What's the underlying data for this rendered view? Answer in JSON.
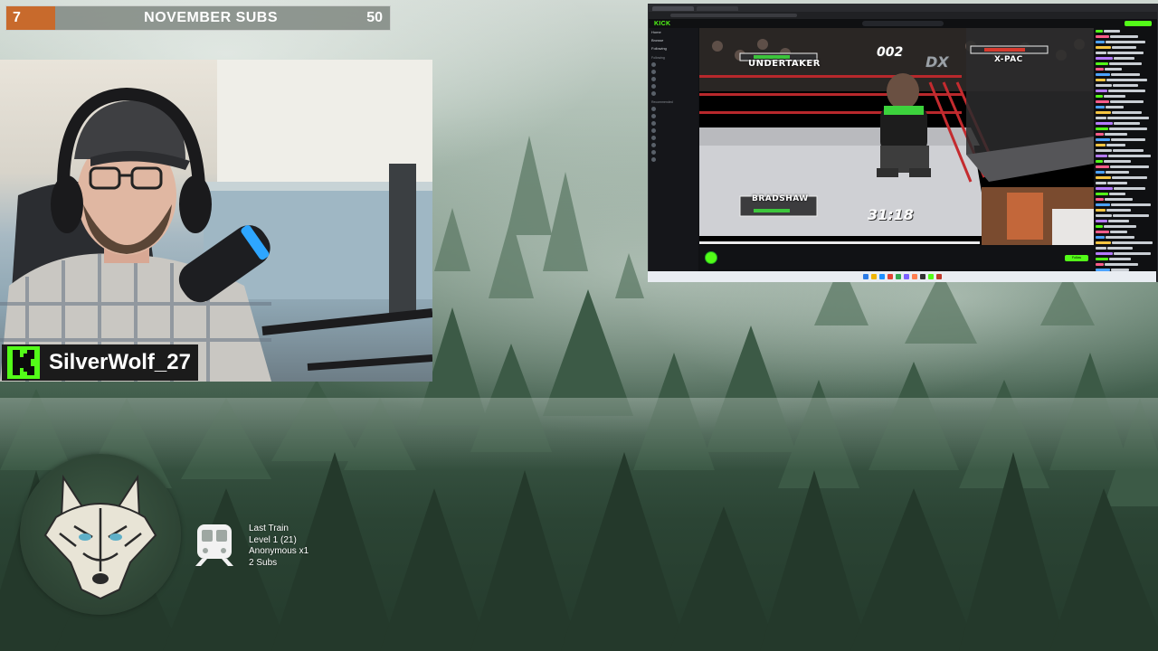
{
  "overlay": {
    "subs_goal": {
      "current": "7",
      "label": "NOVEMBER SUBS",
      "target": "50"
    },
    "streamer": {
      "name": "SilverWolf_27",
      "platform_icon": "kick-logo-icon"
    },
    "last_train": {
      "title": "Last Train",
      "level": "Level 1  (21)",
      "contributor": "Anonymous x1",
      "subs": "2 Subs",
      "icon": "train-icon"
    }
  },
  "browser": {
    "site_logo": "KICK",
    "sidebar": {
      "nav": [
        "Home",
        "Browse",
        "Following"
      ],
      "following_header": "Following",
      "recommended_header": "Recommended"
    },
    "game": {
      "player1_name": "UNDERTAKER",
      "player2_name": "X-PAC",
      "player3_name": "BRADSHAW",
      "counter": "002",
      "timer": "31:18",
      "logo": "DX"
    },
    "follow_label": "Follow"
  },
  "colors": {
    "kick_green": "#53fc18",
    "subs_orange": "#c86a2c"
  }
}
